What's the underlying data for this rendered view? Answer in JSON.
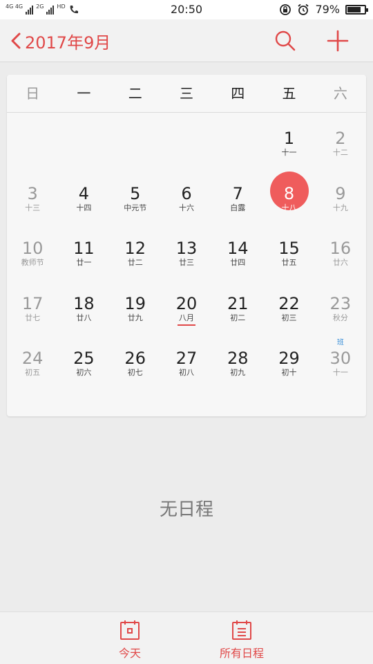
{
  "status": {
    "net1": "4G 4G",
    "net2": "2G",
    "hd": "HD",
    "time": "20:50",
    "battery_pct": "79%",
    "battery_level": 0.79
  },
  "header": {
    "title": "2017年9月",
    "back_icon": "chevron-left-icon",
    "search_icon": "search-icon",
    "add_icon": "plus-icon",
    "accent": "#e04848"
  },
  "weekdays": [
    "日",
    "一",
    "二",
    "三",
    "四",
    "五",
    "六"
  ],
  "calendar": {
    "weeks": [
      [
        {
          "day": "",
          "lunar": ""
        },
        {
          "day": "",
          "lunar": ""
        },
        {
          "day": "",
          "lunar": ""
        },
        {
          "day": "",
          "lunar": ""
        },
        {
          "day": "",
          "lunar": ""
        },
        {
          "day": "1",
          "lunar": "十一"
        },
        {
          "day": "2",
          "lunar": "十二"
        }
      ],
      [
        {
          "day": "3",
          "lunar": "十三"
        },
        {
          "day": "4",
          "lunar": "十四"
        },
        {
          "day": "5",
          "lunar": "中元节"
        },
        {
          "day": "6",
          "lunar": "十六"
        },
        {
          "day": "7",
          "lunar": "白露"
        },
        {
          "day": "8",
          "lunar": "十八",
          "today": true
        },
        {
          "day": "9",
          "lunar": "十九"
        }
      ],
      [
        {
          "day": "10",
          "lunar": "教师节"
        },
        {
          "day": "11",
          "lunar": "廿一"
        },
        {
          "day": "12",
          "lunar": "廿二"
        },
        {
          "day": "13",
          "lunar": "廿三"
        },
        {
          "day": "14",
          "lunar": "廿四"
        },
        {
          "day": "15",
          "lunar": "廿五"
        },
        {
          "day": "16",
          "lunar": "廿六"
        }
      ],
      [
        {
          "day": "17",
          "lunar": "廿七"
        },
        {
          "day": "18",
          "lunar": "廿八"
        },
        {
          "day": "19",
          "lunar": "廿九"
        },
        {
          "day": "20",
          "lunar": "八月",
          "marked": true
        },
        {
          "day": "21",
          "lunar": "初二"
        },
        {
          "day": "22",
          "lunar": "初三"
        },
        {
          "day": "23",
          "lunar": "秋分"
        }
      ],
      [
        {
          "day": "24",
          "lunar": "初五"
        },
        {
          "day": "25",
          "lunar": "初六"
        },
        {
          "day": "26",
          "lunar": "初七"
        },
        {
          "day": "27",
          "lunar": "初八"
        },
        {
          "day": "28",
          "lunar": "初九"
        },
        {
          "day": "29",
          "lunar": "初十"
        },
        {
          "day": "30",
          "lunar": "十一",
          "tag": "班"
        }
      ]
    ],
    "today_color": "#ef5c5c",
    "weekend_color": "#999999"
  },
  "empty_text": "无日程",
  "bottom_tabs": [
    {
      "label": "今天",
      "icon": "calendar-today-icon"
    },
    {
      "label": "所有日程",
      "icon": "calendar-list-icon"
    }
  ]
}
